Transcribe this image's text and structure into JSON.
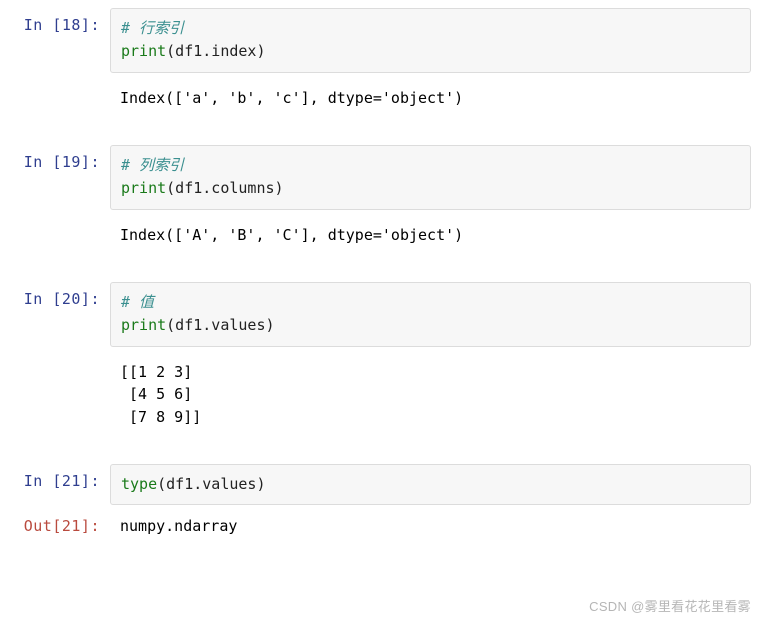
{
  "cells": [
    {
      "prompt_in": "In  [18]:",
      "comment": "# 行索引",
      "code_builtin": "print",
      "code_args": "(df1.index)",
      "output": "Index(['a', 'b', 'c'], dtype='object')"
    },
    {
      "prompt_in": "In  [19]:",
      "comment": "# 列索引",
      "code_builtin": "print",
      "code_args": "(df1.columns)",
      "output": "Index(['A', 'B', 'C'], dtype='object')"
    },
    {
      "prompt_in": "In  [20]:",
      "comment": "# 值",
      "code_builtin": "print",
      "code_args": "(df1.values)",
      "output": "[[1 2 3]\n [4 5 6]\n [7 8 9]]"
    },
    {
      "prompt_in": "In  [21]:",
      "code_builtin": "type",
      "code_args": "(df1.values)",
      "prompt_out": "Out[21]:",
      "output": "numpy.ndarray"
    }
  ],
  "watermark": "CSDN @雾里看花花里看雾"
}
